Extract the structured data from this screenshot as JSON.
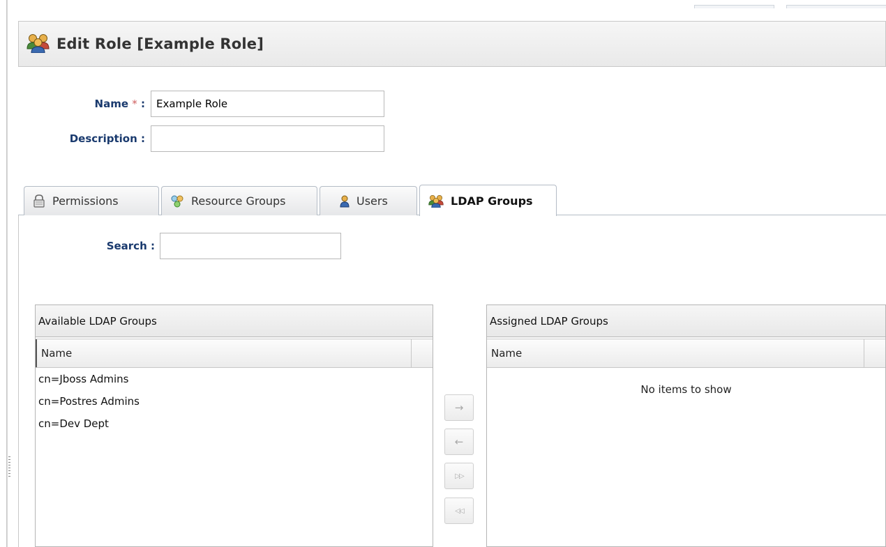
{
  "header": {
    "title": "Edit Role [Example Role]",
    "icon": "group-icon"
  },
  "form": {
    "name_label": "Name",
    "required_mark": "*",
    "colon": ":",
    "name_value": "Example Role",
    "description_label": "Description",
    "description_value": ""
  },
  "tabs": [
    {
      "label": "Permissions",
      "icon": "lock-icon",
      "active": false
    },
    {
      "label": "Resource Groups",
      "icon": "resource-group-icon",
      "active": false
    },
    {
      "label": "Users",
      "icon": "user-icon",
      "active": false
    },
    {
      "label": "LDAP Groups",
      "icon": "group-icon",
      "active": true
    }
  ],
  "search": {
    "label": "Search",
    "value": ""
  },
  "available": {
    "title": "Available LDAP Groups",
    "column": "Name",
    "rows": [
      "cn=Jboss Admins",
      "cn=Postres Admins",
      "cn=Dev Dept"
    ]
  },
  "assigned": {
    "title": "Assigned LDAP Groups",
    "column": "Name",
    "empty_text": "No items to show"
  },
  "move_buttons": [
    {
      "name": "move-right-button",
      "glyph": "→"
    },
    {
      "name": "move-left-button",
      "glyph": "←"
    },
    {
      "name": "move-all-right-button",
      "glyph": "▷▷"
    },
    {
      "name": "move-all-left-button",
      "glyph": "◁◁"
    }
  ]
}
